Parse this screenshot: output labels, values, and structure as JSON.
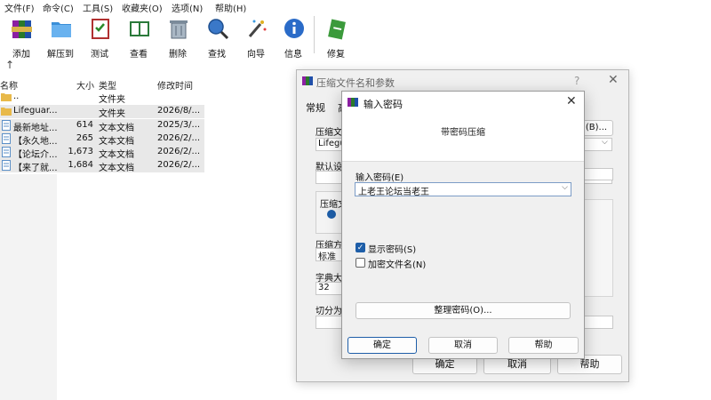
{
  "menu": [
    "文件(F)",
    "命令(C)",
    "工具(S)",
    "收藏夹(O)",
    "选项(N)",
    "帮助(H)"
  ],
  "toolbar": {
    "add": "添加",
    "extract": "解压到",
    "test": "测试",
    "view": "查看",
    "delete": "删除",
    "find": "查找",
    "wizard": "向导",
    "info": "信息",
    "repair": "修复"
  },
  "filelist": {
    "columns": {
      "name": "名称",
      "size": "大小",
      "type": "类型",
      "modified": "修改时间"
    },
    "rows": [
      {
        "name": "..",
        "size": "",
        "type": "文件夹",
        "modified": ""
      },
      {
        "name": "Lifeguar...",
        "size": "",
        "type": "文件夹",
        "modified": "2026/8/..."
      },
      {
        "name": "最新地址...",
        "size": "614",
        "type": "文本文档",
        "modified": "2025/3/..."
      },
      {
        "name": "【永久地...",
        "size": "265",
        "type": "文本文档",
        "modified": "2026/2/..."
      },
      {
        "name": "【论坛介...",
        "size": "1,673",
        "type": "文本文档",
        "modified": "2026/2/..."
      },
      {
        "name": "【来了就...",
        "size": "1,684",
        "type": "文本文档",
        "modified": "2026/2/..."
      }
    ]
  },
  "archive_dialog": {
    "title": "压缩文件名和参数",
    "help": "?",
    "tab_general": "常规",
    "tab_other": "高",
    "archive_name_label": "压缩文件",
    "browse_button": "(B)...",
    "archive_name_value": "Lifegua",
    "default_label": "默认设置",
    "format_label": "压缩文",
    "method_label": "压缩方式",
    "method_value": "标准",
    "dict_label": "字典大小",
    "dict_value": "32",
    "split_label": "切分为分",
    "ok": "确定",
    "cancel": "取消",
    "help_button": "帮助"
  },
  "password_dialog": {
    "title": "输入密码",
    "header": "带密码压缩",
    "password_label": "输入密码(E)",
    "password_value": "上老王论坛当老王",
    "show_password": "显示密码(S)",
    "show_password_checked": true,
    "encrypt_names": "加密文件名(N)",
    "encrypt_names_checked": false,
    "organize_button": "整理密码(O)...",
    "ok": "确定",
    "cancel": "取消",
    "help": "帮助"
  }
}
